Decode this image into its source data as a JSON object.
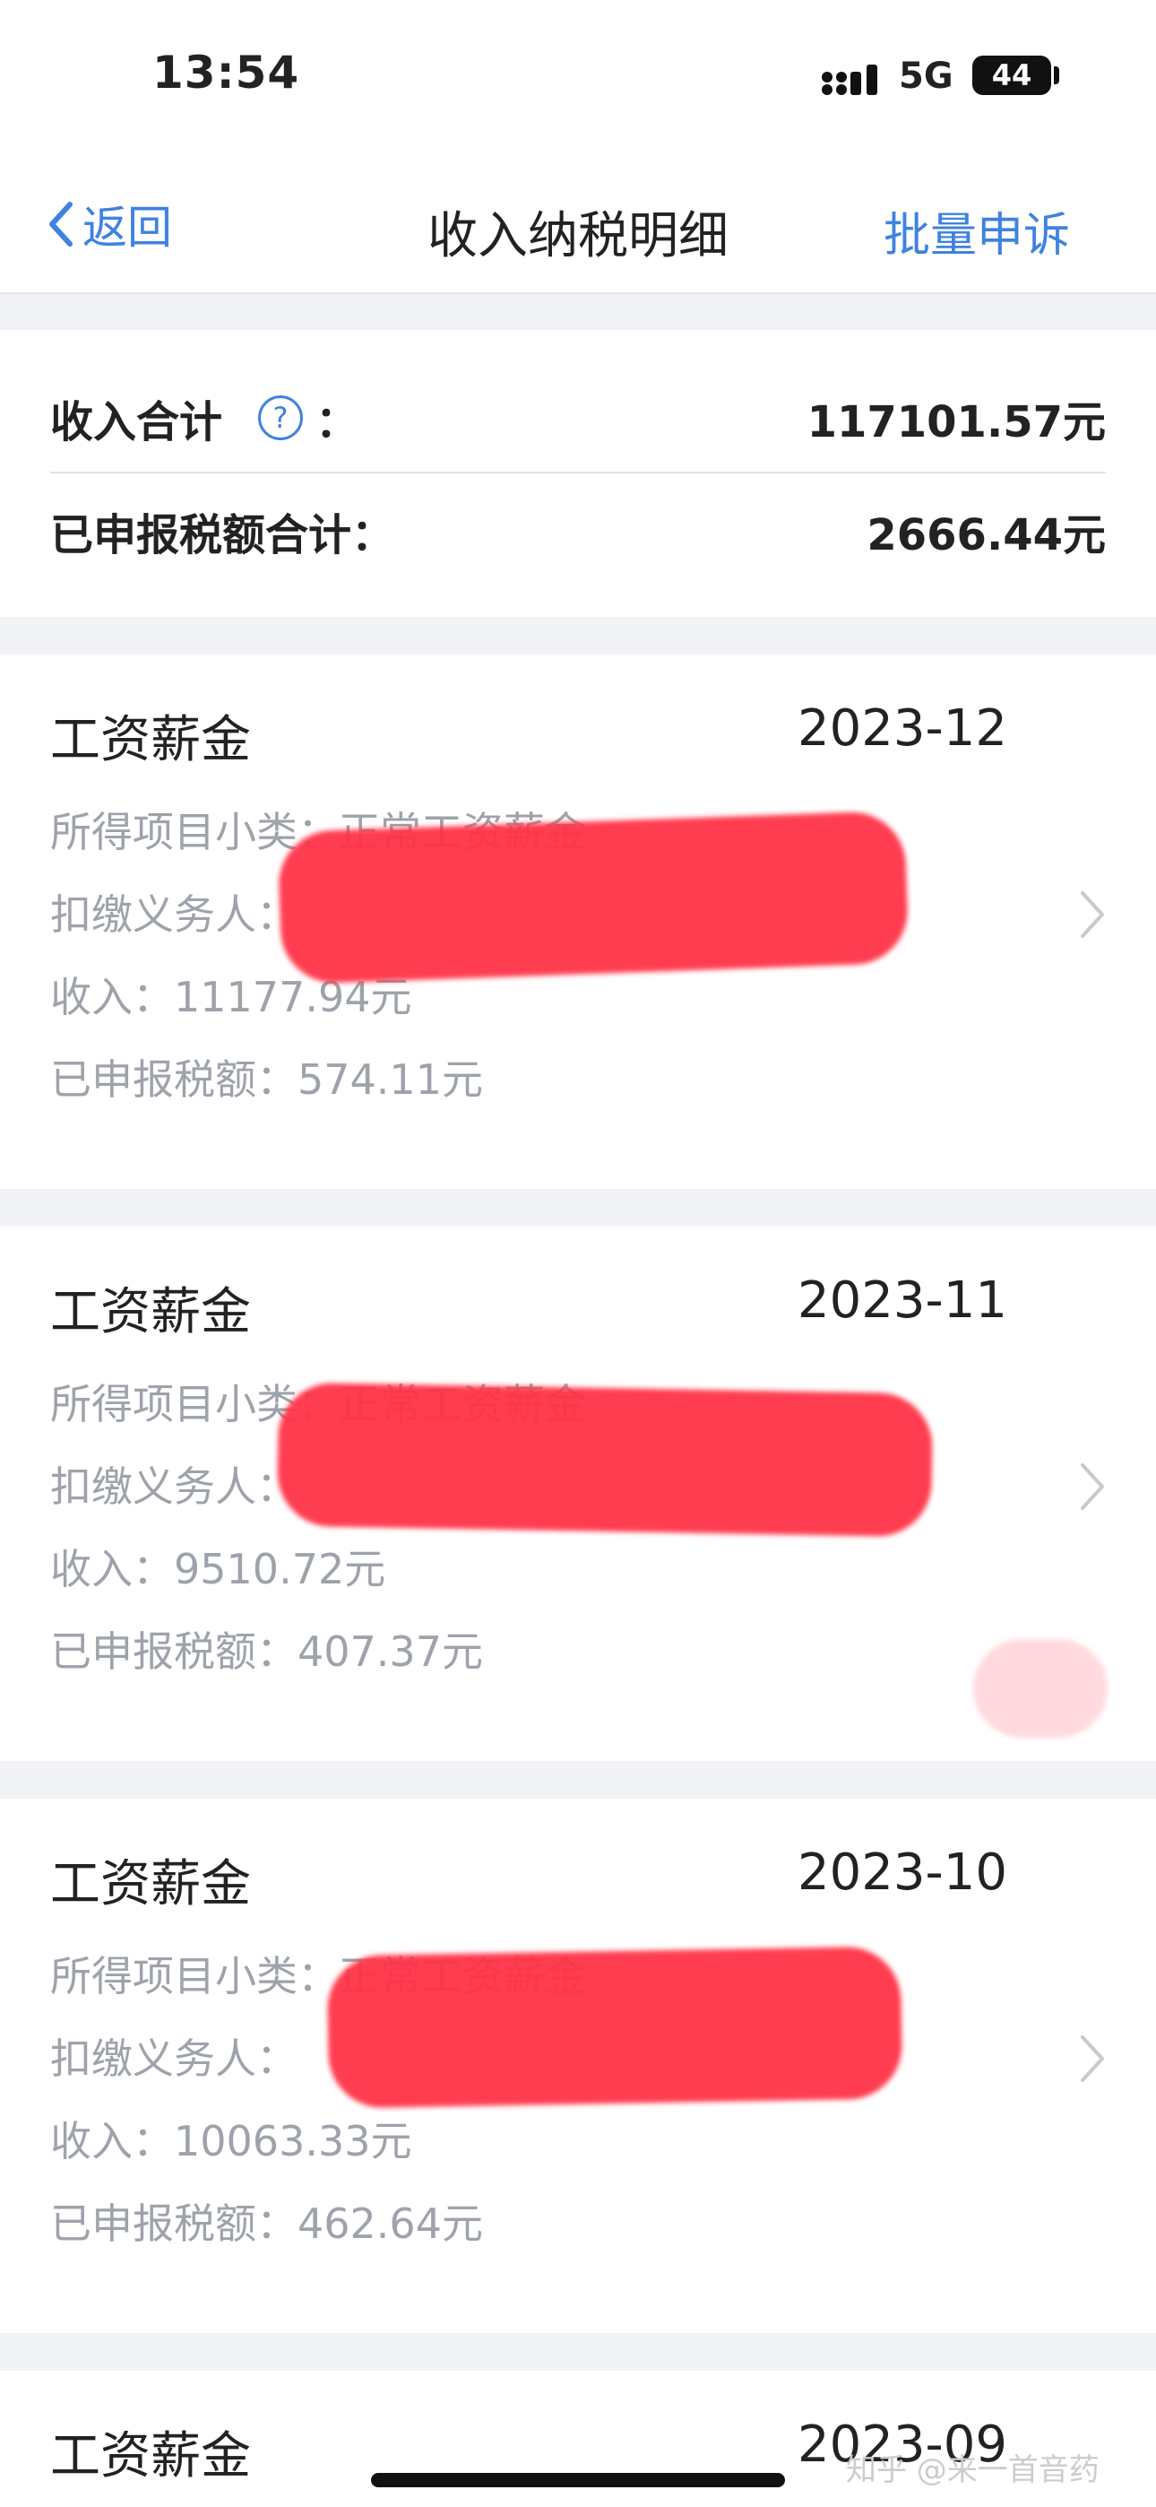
{
  "status_bar": {
    "time": "13:54",
    "network": "5G",
    "battery": "44"
  },
  "nav": {
    "back_label": "返回",
    "title": "收入纳税明细",
    "batch_appeal_label": "批量申诉"
  },
  "summary": {
    "income_total_label": "收入合计",
    "income_total_value": "117101.57元",
    "tax_total_label": "已申报税额合计：",
    "tax_total_value": "2666.44元"
  },
  "records": [
    {
      "type": "工资薪金",
      "period": "2023-12",
      "subcategory_line": "所得项目小类：正常工资薪金",
      "withholder_line": "扣缴义务人：",
      "income_line": "收入：11177.94元",
      "tax_line": "已申报税额：574.11元"
    },
    {
      "type": "工资薪金",
      "period": "2023-11",
      "subcategory_line": "所得项目小类：正常工资薪金",
      "withholder_line": "扣缴义务人：",
      "income_line": "收入：9510.72元",
      "tax_line": "已申报税额：407.37元"
    },
    {
      "type": "工资薪金",
      "period": "2023-10",
      "subcategory_line": "所得项目小类：正常工资薪金",
      "withholder_line": "扣缴义务人：",
      "income_line": "收入：10063.33元",
      "tax_line": "已申报税额：462.64元"
    },
    {
      "type": "工资薪金",
      "period": "2023-09"
    }
  ],
  "watermark": "知乎 @来一首音药",
  "colors": {
    "accent": "#3f82e0",
    "redaction": "#ff3347"
  }
}
